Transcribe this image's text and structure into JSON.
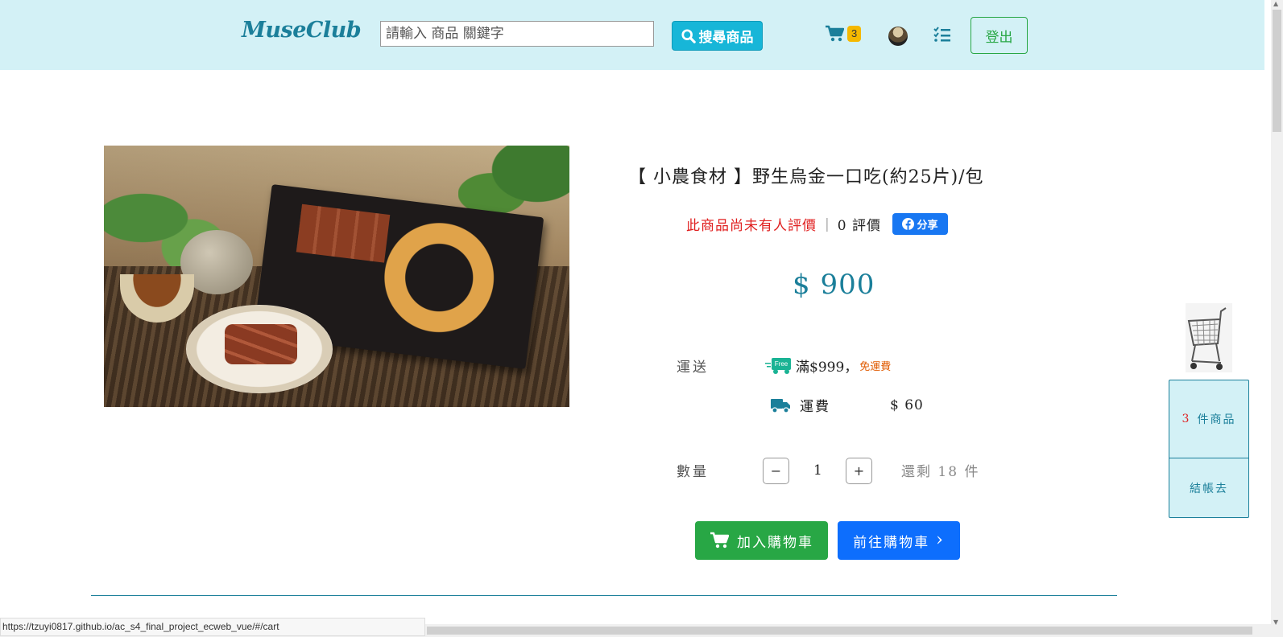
{
  "navbar": {
    "brand": "MuseClub",
    "search_placeholder": "請輸入 商品 關鍵字",
    "search_button": "搜尋商品",
    "cart_count": "3",
    "logout": "登出"
  },
  "product": {
    "title": "【 小農食材 】野生烏金一口吃(約25片)/包",
    "no_review_text": "此商品尚未有人評價",
    "review_count": "0 評價",
    "share_label": "分享",
    "price": "$ 900",
    "shipping_label": "運送",
    "free_badge": "Free",
    "free_threshold": "滿$999，",
    "free_note": "免運費",
    "shipping_fee_label": "運費",
    "shipping_fee": "$ 60",
    "quantity_label": "數量",
    "quantity_value": "1",
    "minus": "−",
    "plus": "+",
    "stock_text": "還剩 18 件",
    "add_to_cart": "加入購物車",
    "go_to_cart": "前往購物車",
    "go_to_cart_arrow": "›"
  },
  "float_cart": {
    "count": "3",
    "count_suffix": "件商品",
    "checkout": "結帳去"
  },
  "status_bar": {
    "url": "https://tzuyi0817.github.io/ac_s4_final_project_ecweb_vue/#/cart"
  },
  "colors": {
    "navbar_bg": "#d3f1f6",
    "brand": "#1b7f9a",
    "search_button": "#17b6d8",
    "add_to_cart": "#28a745",
    "go_to_cart": "#0d6efd",
    "badge": "#f5b800",
    "warning_red": "#e02020"
  },
  "icons": [
    "search-icon",
    "cart-icon",
    "avatar",
    "task-list-icon",
    "facebook-icon",
    "free-shipping-truck-icon",
    "truck-icon",
    "shopping-cart-icon",
    "chevron-right-icon",
    "shopping-trolley-icon"
  ]
}
